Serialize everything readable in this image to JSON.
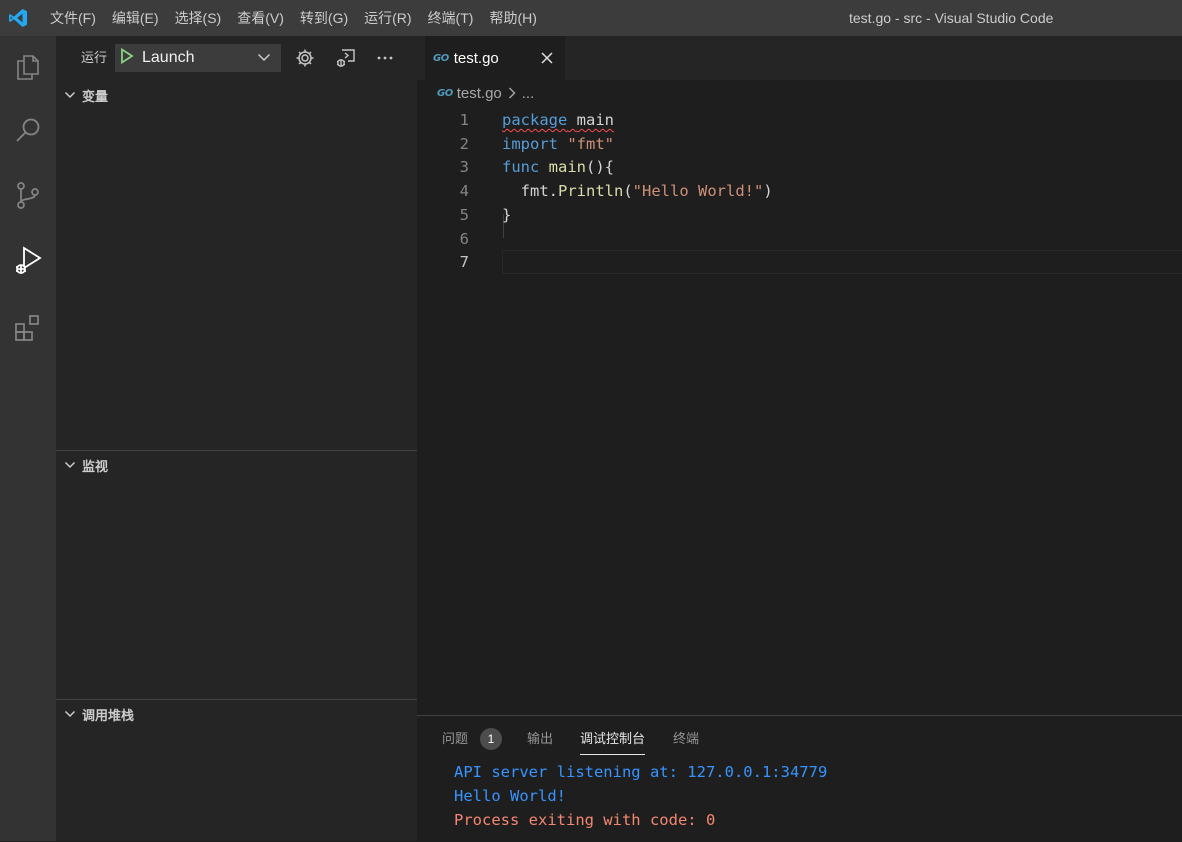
{
  "window": {
    "title": "test.go - src - Visual Studio Code",
    "menu": [
      "文件(F)",
      "编辑(E)",
      "选择(S)",
      "查看(V)",
      "转到(G)",
      "运行(R)",
      "终端(T)",
      "帮助(H)"
    ]
  },
  "activity_bar": {
    "items": [
      "explorer-icon",
      "search-icon",
      "source-control-icon",
      "run-debug-icon",
      "extensions-icon"
    ],
    "active": "run-debug-icon"
  },
  "sidebar": {
    "run_label": "运行",
    "launch_config": "Launch",
    "sections": [
      "变量",
      "监视",
      "调用堆栈"
    ]
  },
  "editor": {
    "tab": {
      "label": "test.go",
      "icon_text": "GO"
    },
    "breadcrumb": {
      "file": "test.go",
      "more": "..."
    },
    "lines": [
      {
        "num": "1",
        "tokens": [
          {
            "t": "package",
            "c": "kw",
            "squig": true
          },
          {
            "t": " ",
            "c": "txt",
            "squig": true
          },
          {
            "t": "main",
            "c": "txt",
            "squig": true
          }
        ]
      },
      {
        "num": "2",
        "tokens": [
          {
            "t": "import",
            "c": "kw"
          },
          {
            "t": " ",
            "c": "txt"
          },
          {
            "t": "\"fmt\"",
            "c": "str"
          }
        ]
      },
      {
        "num": "3",
        "tokens": [
          {
            "t": "func",
            "c": "kw"
          },
          {
            "t": " ",
            "c": "txt"
          },
          {
            "t": "main",
            "c": "fn"
          },
          {
            "t": "(){",
            "c": "txt"
          }
        ]
      },
      {
        "num": "4",
        "tokens": [
          {
            "t": "  fmt.",
            "c": "txt"
          },
          {
            "t": "Println",
            "c": "fn"
          },
          {
            "t": "(",
            "c": "txt"
          },
          {
            "t": "\"Hello World!\"",
            "c": "str"
          },
          {
            "t": ")",
            "c": "txt"
          }
        ]
      },
      {
        "num": "5",
        "tokens": [
          {
            "t": "}",
            "c": "txt"
          }
        ]
      },
      {
        "num": "6",
        "tokens": []
      },
      {
        "num": "7",
        "tokens": []
      }
    ],
    "active_line": "7"
  },
  "panel": {
    "tabs": [
      {
        "label": "问题",
        "badge": "1"
      },
      {
        "label": "输出"
      },
      {
        "label": "调试控制台",
        "active": true
      },
      {
        "label": "终端"
      }
    ],
    "console": [
      {
        "text": "API server listening at: 127.0.0.1:34779",
        "color": "blue"
      },
      {
        "text": "Hello World!",
        "color": "blue"
      },
      {
        "text": "Process exiting with code: 0",
        "color": "orange"
      }
    ]
  },
  "colors": {
    "accent_blue": "#007acc",
    "play_green": "#89d185",
    "console_blue": "#3794ff",
    "console_orange": "#f48771"
  }
}
